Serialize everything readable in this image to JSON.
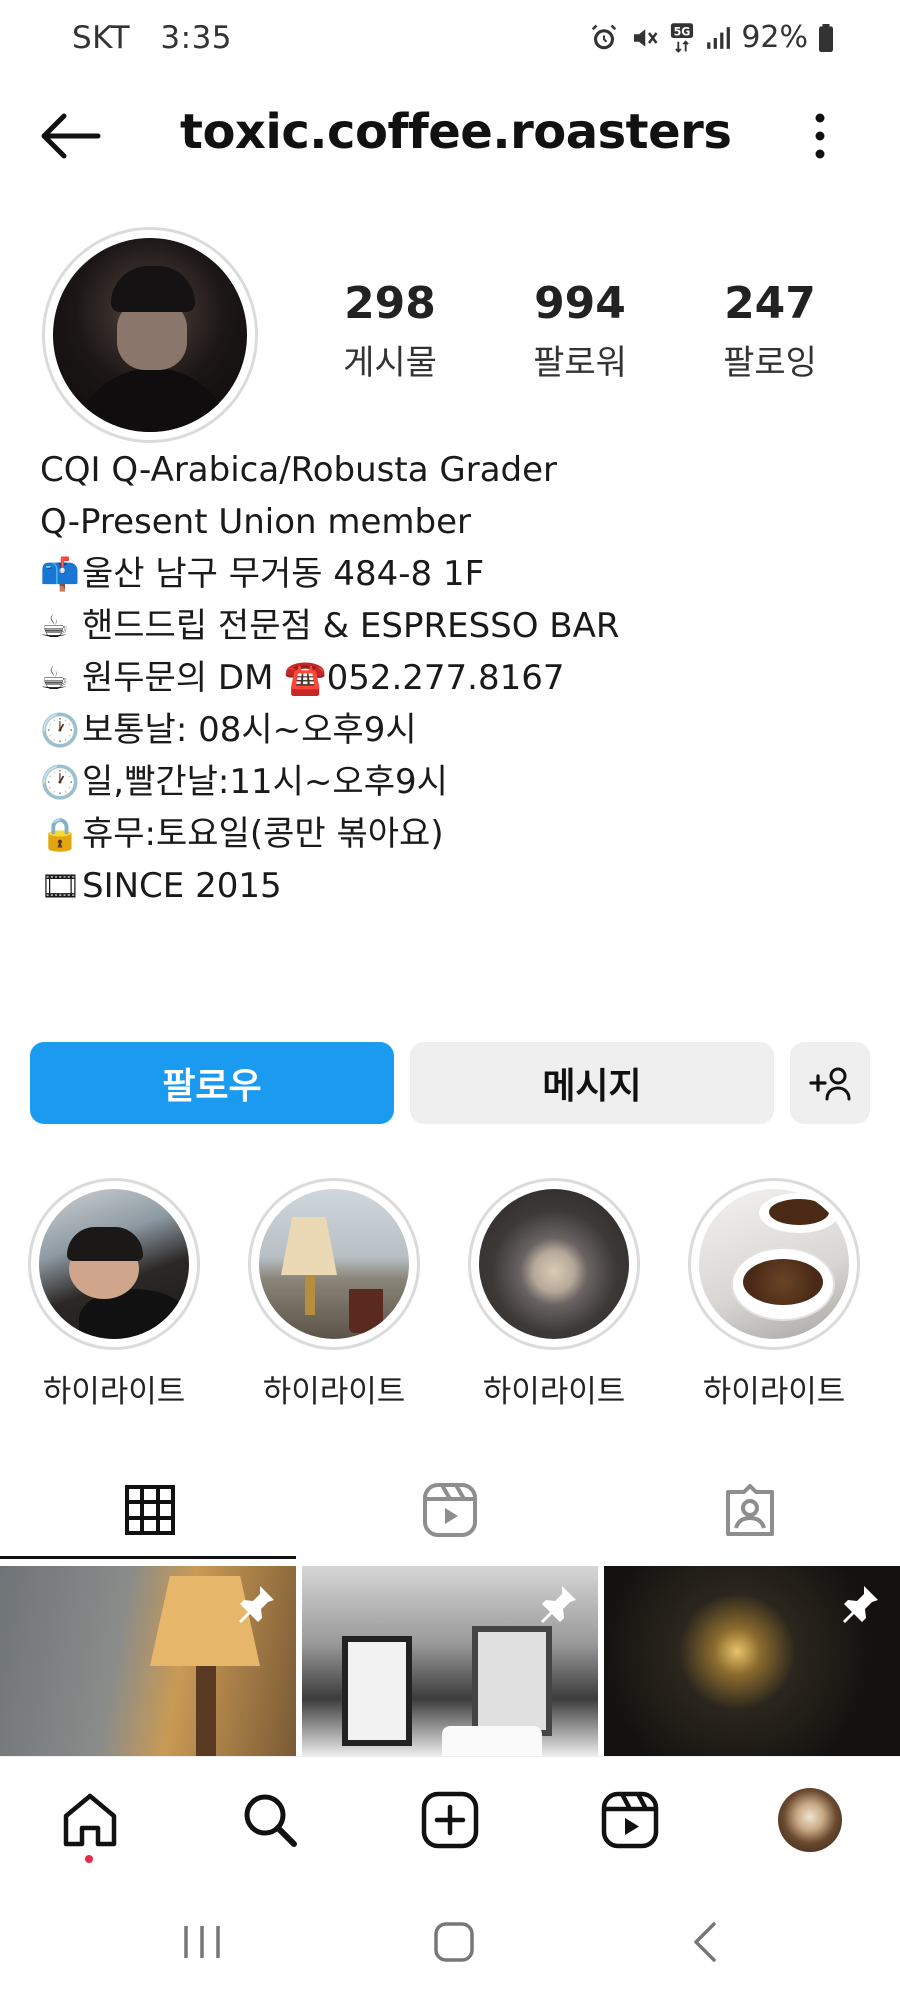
{
  "status_bar": {
    "carrier": "SKT",
    "time": "3:35",
    "network": "5G",
    "battery": "92%",
    "icons": [
      "alarm-icon",
      "mute-icon",
      "5g-icon",
      "signal-icon",
      "battery-icon"
    ]
  },
  "header": {
    "username": "toxic.coffee.roasters",
    "back_icon": "arrow-left-icon",
    "more_icon": "more-vertical-icon"
  },
  "profile": {
    "stats": [
      {
        "count": "298",
        "label": "게시물"
      },
      {
        "count": "994",
        "label": "팔로워"
      },
      {
        "count": "247",
        "label": "팔로잉"
      }
    ],
    "bio": [
      {
        "icon": "",
        "text": "CQI Q-Arabica/Robusta Grader"
      },
      {
        "icon": "📫",
        "text": "Q-Present Union member"
      },
      {
        "icon": "📫",
        "text": "울산 남구 무거동 484-8 1F"
      },
      {
        "icon": "☕",
        "text": "핸드드립 전문점 & ESPRESSO BAR"
      },
      {
        "icon": "☕",
        "text": "원두문의 DM ☎️052.277.8167"
      },
      {
        "icon": "🕐",
        "text": "보통날: 08시~오후9시"
      },
      {
        "icon": "🕐",
        "text": "일,빨간날:11시~오후9시"
      },
      {
        "icon": "🔒",
        "text": "휴무:토요일(콩만 볶아요)"
      },
      {
        "icon": "🎞",
        "text": "SINCE 2015"
      }
    ]
  },
  "actions": {
    "follow_label": "팔로우",
    "message_label": "메시지",
    "add_icon": "add-person-icon"
  },
  "highlights": [
    {
      "label": "하이라이트"
    },
    {
      "label": "하이라이트"
    },
    {
      "label": "하이라이트"
    },
    {
      "label": "하이라이트"
    }
  ],
  "tabs": [
    {
      "name": "grid",
      "icon": "grid-icon",
      "active": true
    },
    {
      "name": "reels",
      "icon": "reels-icon",
      "active": false
    },
    {
      "name": "tagged",
      "icon": "tagged-icon",
      "active": false
    }
  ],
  "bottom_nav": [
    "home-icon",
    "search-icon",
    "create-icon",
    "reels-icon",
    "profile-avatar"
  ],
  "colors": {
    "accent": "#1a9bf0",
    "secondary_button": "#efefef",
    "notification_dot": "#e8284b"
  }
}
